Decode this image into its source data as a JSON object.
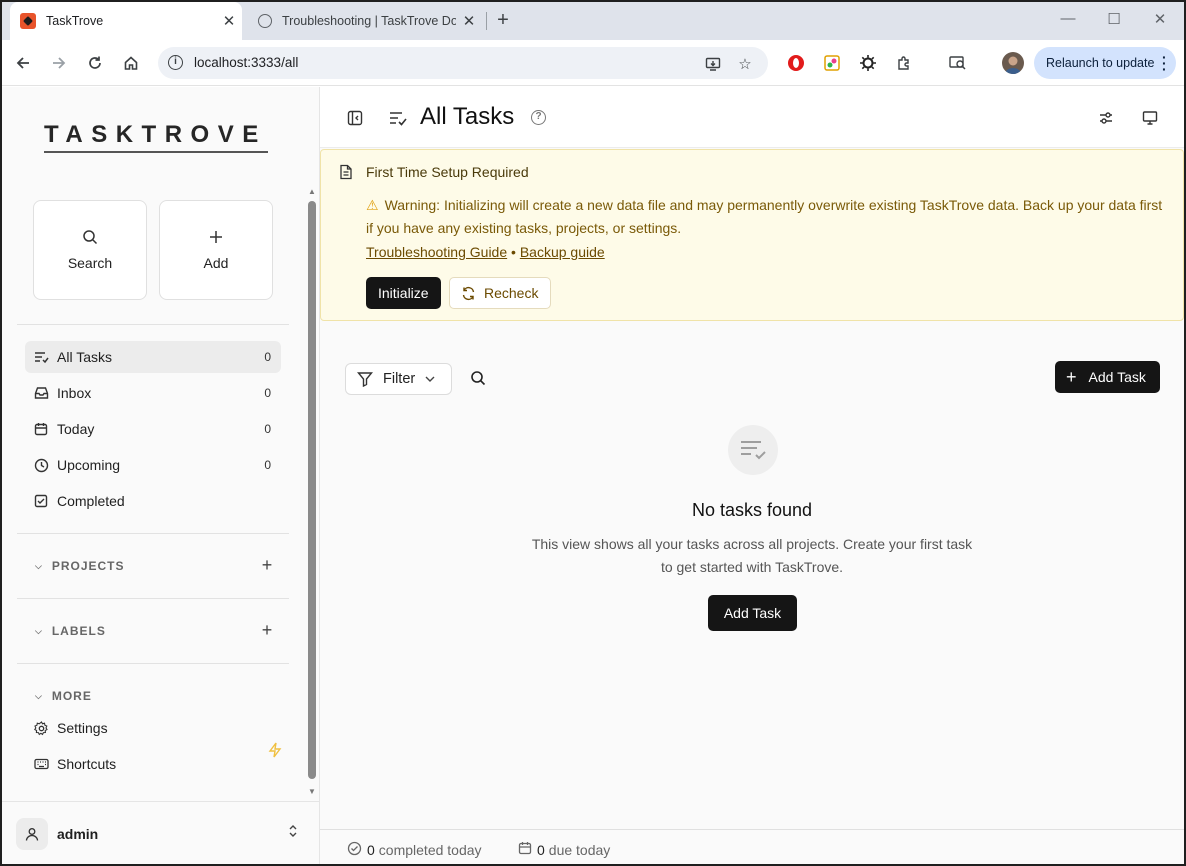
{
  "browser": {
    "tabs": [
      {
        "title": "TaskTrove",
        "active": true
      },
      {
        "title": "Troubleshooting | TaskTrove Do",
        "active": false
      }
    ],
    "url": "localhost:3333/all",
    "relaunch_label": "Relaunch to update"
  },
  "sidebar": {
    "logo": "TASKTROVE",
    "quick_actions": {
      "search": "Search",
      "add": "Add"
    },
    "nav": [
      {
        "label": "All Tasks",
        "count": "0",
        "icon": "all-tasks-icon"
      },
      {
        "label": "Inbox",
        "count": "0",
        "icon": "inbox-icon"
      },
      {
        "label": "Today",
        "count": "0",
        "icon": "calendar-icon"
      },
      {
        "label": "Upcoming",
        "count": "0",
        "icon": "clock-icon"
      },
      {
        "label": "Completed",
        "count": "",
        "icon": "check-square-icon"
      }
    ],
    "projects_label": "PROJECTS",
    "labels_label": "LABELS",
    "more_label": "MORE",
    "more_items": [
      {
        "label": "Settings",
        "icon": "gear-icon"
      },
      {
        "label": "Shortcuts",
        "icon": "keyboard-icon"
      }
    ],
    "user": {
      "name": "admin"
    }
  },
  "main": {
    "title": "All Tasks",
    "banner": {
      "title": "First Time Setup Required",
      "warning": "Warning: Initializing will create a new data file and may permanently overwrite existing TaskTrove data. Back up your data first if you have any existing tasks, projects, or settings.",
      "link1": "Troubleshooting Guide",
      "sep": "•",
      "link2": "Backup guide",
      "initialize_label": "Initialize",
      "recheck_label": "Recheck"
    },
    "filter_label": "Filter",
    "add_task_label": "Add Task",
    "empty": {
      "title": "No tasks found",
      "description": "This view shows all your tasks across all projects. Create your first task to get started with TaskTrove.",
      "button": "Add Task"
    },
    "footer": {
      "completed_count": "0",
      "completed_label": "completed today",
      "due_count": "0",
      "due_label": "due today"
    }
  },
  "colors": {
    "accent_dark": "#151515",
    "banner_bg": "#fefbe8",
    "banner_text": "#7a5a08",
    "relaunch_bg": "#d3e3fd"
  }
}
